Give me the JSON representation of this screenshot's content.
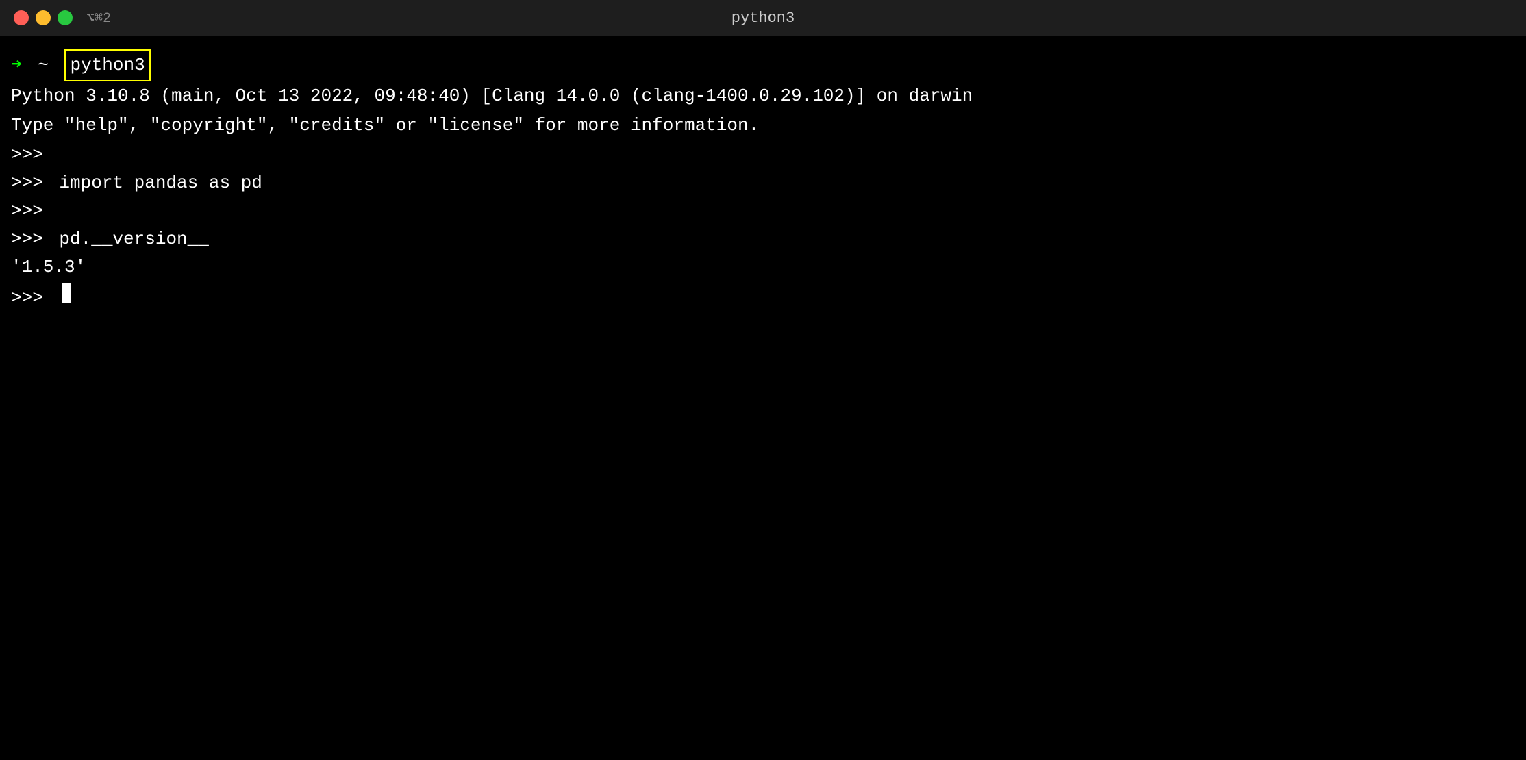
{
  "titleBar": {
    "title": "python3",
    "shortcut": "⌥⌘2",
    "trafficLights": {
      "close": "close",
      "minimize": "minimize",
      "maximize": "maximize"
    }
  },
  "terminal": {
    "initialPrompt": {
      "arrow": "➜",
      "tilde": "~",
      "command": "python3"
    },
    "lines": [
      {
        "type": "output",
        "text": "Python 3.10.8 (main, Oct 13 2022, 09:48:40) [Clang 14.0.0 (clang-1400.0.29.102)] on darwin"
      },
      {
        "type": "output",
        "text": "Type \"help\", \"copyright\", \"credits\" or \"license\" for more information."
      },
      {
        "type": "prompt-empty",
        "prompt": ">>>"
      },
      {
        "type": "prompt-command",
        "prompt": ">>>",
        "command": "import pandas as pd"
      },
      {
        "type": "prompt-empty",
        "prompt": ">>>"
      },
      {
        "type": "prompt-command",
        "prompt": ">>>",
        "command": "pd.__version__"
      },
      {
        "type": "output",
        "text": "'1.5.3'"
      },
      {
        "type": "prompt-cursor",
        "prompt": ">>>"
      }
    ]
  }
}
